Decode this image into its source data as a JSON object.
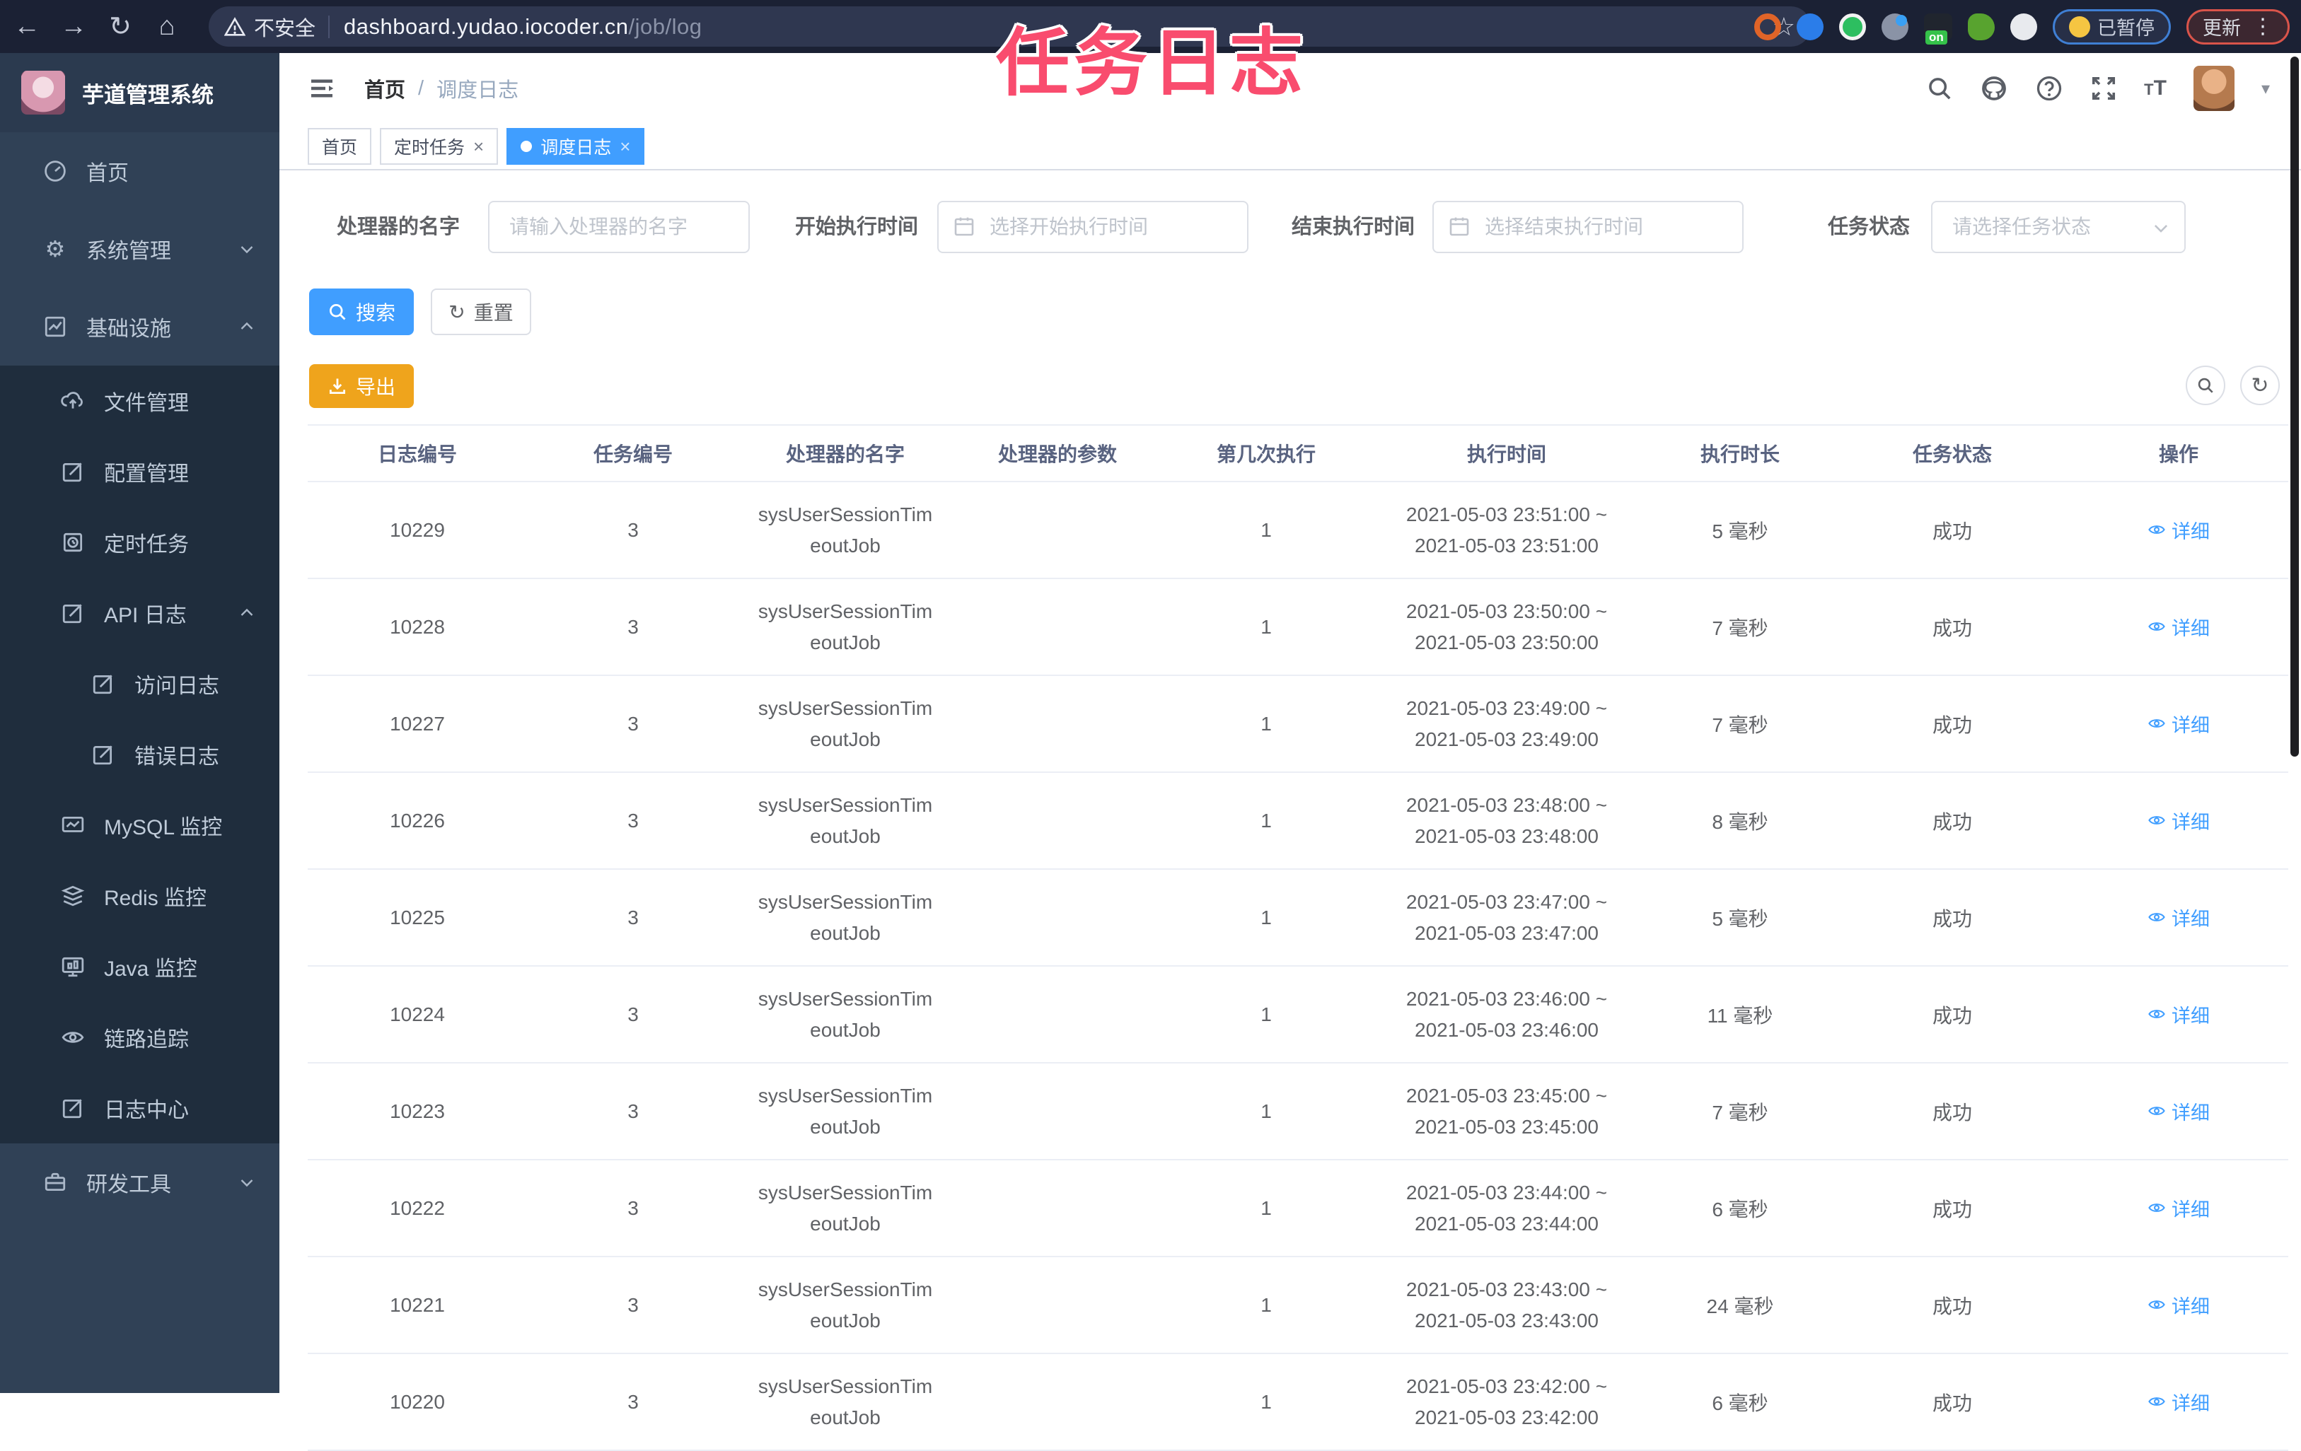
{
  "browser": {
    "security_warning": "不安全",
    "url_domain": "dashboard.yudao.iocoder.cn",
    "url_path": "/job/log",
    "paused_badge": "已暂停",
    "update_button": "更新"
  },
  "overlay_title": "任务日志",
  "sidebar": {
    "app_title": "芋道管理系统",
    "items": [
      {
        "label": "首页"
      },
      {
        "label": "系统管理"
      },
      {
        "label": "基础设施"
      },
      {
        "label": "文件管理"
      },
      {
        "label": "配置管理"
      },
      {
        "label": "定时任务"
      },
      {
        "label": "API 日志"
      },
      {
        "label": "访问日志"
      },
      {
        "label": "错误日志"
      },
      {
        "label": "MySQL 监控"
      },
      {
        "label": "Redis 监控"
      },
      {
        "label": "Java 监控"
      },
      {
        "label": "链路追踪"
      },
      {
        "label": "日志中心"
      },
      {
        "label": "研发工具"
      }
    ]
  },
  "breadcrumb": {
    "home": "首页",
    "current": "调度日志"
  },
  "tabs": [
    {
      "label": "首页",
      "closable": false,
      "active": false
    },
    {
      "label": "定时任务",
      "closable": true,
      "active": false
    },
    {
      "label": "调度日志",
      "closable": true,
      "active": true
    }
  ],
  "filters": {
    "handler_label": "处理器的名字",
    "handler_placeholder": "请输入处理器的名字",
    "start_label": "开始执行时间",
    "start_placeholder": "选择开始执行时间",
    "end_label": "结束执行时间",
    "end_placeholder": "选择结束执行时间",
    "status_label": "任务状态",
    "status_placeholder": "请选择任务状态",
    "search_label": "搜索",
    "reset_label": "重置"
  },
  "toolbar": {
    "export_label": "导出"
  },
  "table": {
    "columns": [
      "日志编号",
      "任务编号",
      "处理器的名字",
      "处理器的参数",
      "第几次执行",
      "执行时间",
      "执行时长",
      "任务状态",
      "操作"
    ],
    "detail_label": "详细",
    "rows": [
      {
        "log_id": "10229",
        "task_id": "3",
        "handler_line1": "sysUserSessionTim",
        "handler_line2": "eoutJob",
        "param": "",
        "count": "1",
        "time_line1": "2021-05-03 23:51:00 ~",
        "time_line2": "2021-05-03 23:51:00",
        "duration": "5 毫秒",
        "status": "成功"
      },
      {
        "log_id": "10228",
        "task_id": "3",
        "handler_line1": "sysUserSessionTim",
        "handler_line2": "eoutJob",
        "param": "",
        "count": "1",
        "time_line1": "2021-05-03 23:50:00 ~",
        "time_line2": "2021-05-03 23:50:00",
        "duration": "7 毫秒",
        "status": "成功"
      },
      {
        "log_id": "10227",
        "task_id": "3",
        "handler_line1": "sysUserSessionTim",
        "handler_line2": "eoutJob",
        "param": "",
        "count": "1",
        "time_line1": "2021-05-03 23:49:00 ~",
        "time_line2": "2021-05-03 23:49:00",
        "duration": "7 毫秒",
        "status": "成功"
      },
      {
        "log_id": "10226",
        "task_id": "3",
        "handler_line1": "sysUserSessionTim",
        "handler_line2": "eoutJob",
        "param": "",
        "count": "1",
        "time_line1": "2021-05-03 23:48:00 ~",
        "time_line2": "2021-05-03 23:48:00",
        "duration": "8 毫秒",
        "status": "成功"
      },
      {
        "log_id": "10225",
        "task_id": "3",
        "handler_line1": "sysUserSessionTim",
        "handler_line2": "eoutJob",
        "param": "",
        "count": "1",
        "time_line1": "2021-05-03 23:47:00 ~",
        "time_line2": "2021-05-03 23:47:00",
        "duration": "5 毫秒",
        "status": "成功"
      },
      {
        "log_id": "10224",
        "task_id": "3",
        "handler_line1": "sysUserSessionTim",
        "handler_line2": "eoutJob",
        "param": "",
        "count": "1",
        "time_line1": "2021-05-03 23:46:00 ~",
        "time_line2": "2021-05-03 23:46:00",
        "duration": "11 毫秒",
        "status": "成功"
      },
      {
        "log_id": "10223",
        "task_id": "3",
        "handler_line1": "sysUserSessionTim",
        "handler_line2": "eoutJob",
        "param": "",
        "count": "1",
        "time_line1": "2021-05-03 23:45:00 ~",
        "time_line2": "2021-05-03 23:45:00",
        "duration": "7 毫秒",
        "status": "成功"
      },
      {
        "log_id": "10222",
        "task_id": "3",
        "handler_line1": "sysUserSessionTim",
        "handler_line2": "eoutJob",
        "param": "",
        "count": "1",
        "time_line1": "2021-05-03 23:44:00 ~",
        "time_line2": "2021-05-03 23:44:00",
        "duration": "6 毫秒",
        "status": "成功"
      },
      {
        "log_id": "10221",
        "task_id": "3",
        "handler_line1": "sysUserSessionTim",
        "handler_line2": "eoutJob",
        "param": "",
        "count": "1",
        "time_line1": "2021-05-03 23:43:00 ~",
        "time_line2": "2021-05-03 23:43:00",
        "duration": "24 毫秒",
        "status": "成功"
      },
      {
        "log_id": "10220",
        "task_id": "3",
        "handler_line1": "sysUserSessionTim",
        "handler_line2": "eoutJob",
        "param": "",
        "count": "1",
        "time_line1": "2021-05-03 23:42:00 ~",
        "time_line2": "2021-05-03 23:42:00",
        "duration": "6 毫秒",
        "status": "成功"
      }
    ]
  },
  "colors": {
    "accent": "#409eff",
    "warning_button": "#efa41c",
    "overlay_pink": "#f94c6e",
    "sidebar_bg": "#304156",
    "submenu_bg": "#1f2d3d",
    "link": "#409eff"
  }
}
